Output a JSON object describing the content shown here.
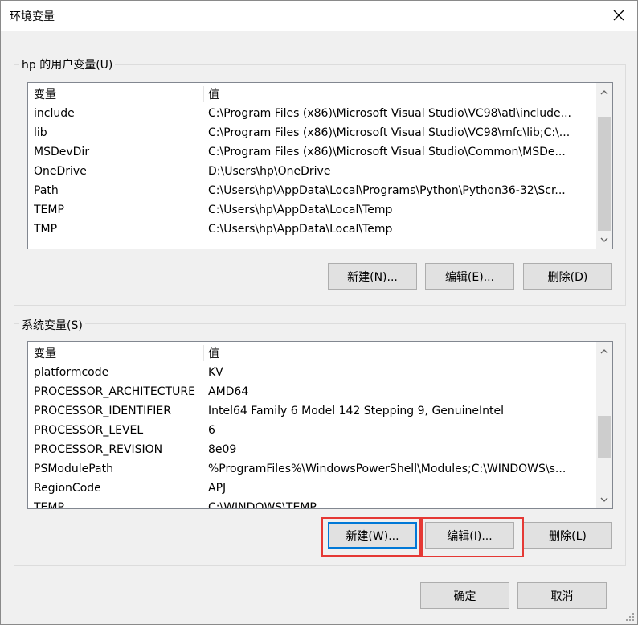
{
  "window": {
    "title": "环境变量"
  },
  "user_vars": {
    "group_label": "hp 的用户变量(U)",
    "col_name": "变量",
    "col_value": "值",
    "rows": [
      {
        "name": "include",
        "value": "C:\\Program Files (x86)\\Microsoft Visual Studio\\VC98\\atl\\include..."
      },
      {
        "name": "lib",
        "value": "C:\\Program Files (x86)\\Microsoft Visual Studio\\VC98\\mfc\\lib;C:\\..."
      },
      {
        "name": "MSDevDir",
        "value": "C:\\Program Files (x86)\\Microsoft Visual Studio\\Common\\MSDe..."
      },
      {
        "name": "OneDrive",
        "value": "D:\\Users\\hp\\OneDrive"
      },
      {
        "name": "Path",
        "value": "C:\\Users\\hp\\AppData\\Local\\Programs\\Python\\Python36-32\\Scr..."
      },
      {
        "name": "TEMP",
        "value": "C:\\Users\\hp\\AppData\\Local\\Temp"
      },
      {
        "name": "TMP",
        "value": "C:\\Users\\hp\\AppData\\Local\\Temp"
      }
    ],
    "buttons": {
      "new": "新建(N)...",
      "edit": "编辑(E)...",
      "delete": "删除(D)"
    }
  },
  "system_vars": {
    "group_label": "系统变量(S)",
    "col_name": "变量",
    "col_value": "值",
    "rows": [
      {
        "name": "platformcode",
        "value": "KV"
      },
      {
        "name": "PROCESSOR_ARCHITECTURE",
        "value": "AMD64"
      },
      {
        "name": "PROCESSOR_IDENTIFIER",
        "value": "Intel64 Family 6 Model 142 Stepping 9, GenuineIntel"
      },
      {
        "name": "PROCESSOR_LEVEL",
        "value": "6"
      },
      {
        "name": "PROCESSOR_REVISION",
        "value": "8e09"
      },
      {
        "name": "PSModulePath",
        "value": "%ProgramFiles%\\WindowsPowerShell\\Modules;C:\\WINDOWS\\s..."
      },
      {
        "name": "RegionCode",
        "value": "APJ"
      },
      {
        "name": "TEMP",
        "value": "C:\\WINDOWS\\TEMP"
      }
    ],
    "buttons": {
      "new": "新建(W)...",
      "edit": "编辑(I)...",
      "delete": "删除(L)"
    }
  },
  "footer": {
    "ok": "确定",
    "cancel": "取消"
  },
  "colors": {
    "highlight": "#e53935",
    "focus": "#0078d7"
  }
}
